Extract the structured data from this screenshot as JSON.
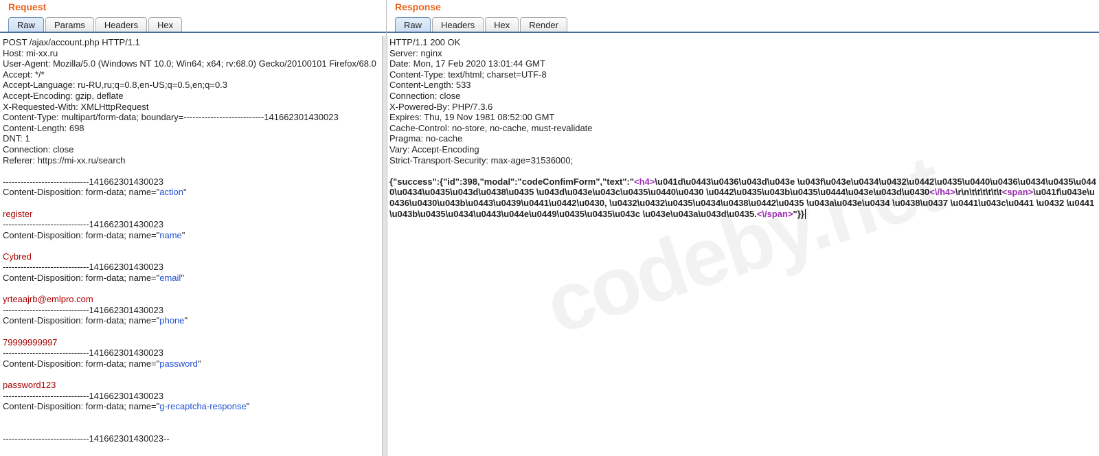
{
  "watermark": "codeby.net",
  "request": {
    "title": "Request",
    "tabs": [
      "Raw",
      "Params",
      "Headers",
      "Hex"
    ],
    "active_tab": 0,
    "request_line": "POST /ajax/account.php HTTP/1.1",
    "headers": [
      "Host: mi-xx.ru",
      "User-Agent: Mozilla/5.0 (Windows NT 10.0; Win64; x64; rv:68.0) Gecko/20100101 Firefox/68.0",
      "Accept: */*",
      "Accept-Language: ru-RU,ru;q=0.8,en-US;q=0.5,en;q=0.3",
      "Accept-Encoding: gzip, deflate",
      "X-Requested-With: XMLHttpRequest",
      "Content-Type: multipart/form-data; boundary=---------------------------141662301430023",
      "Content-Length: 698",
      "DNT: 1",
      "Connection: close",
      "Referer: https://mi-xx.ru/search"
    ],
    "boundary_line": "-----------------------------141662301430023",
    "boundary_end": "-----------------------------141662301430023--",
    "cd_prefix": "Content-Disposition: form-data; name=\"",
    "cd_suffix": "\"",
    "fields": [
      {
        "name": "action",
        "value": "register"
      },
      {
        "name": "name",
        "value": "Cybred"
      },
      {
        "name": "email",
        "value": "yrteaajrb@emlpro.com"
      },
      {
        "name": "phone",
        "value": "79999999997"
      },
      {
        "name": "password",
        "value": "password123"
      },
      {
        "name": "g-recaptcha-response",
        "value": ""
      }
    ]
  },
  "response": {
    "title": "Response",
    "tabs": [
      "Raw",
      "Headers",
      "Hex",
      "Render"
    ],
    "active_tab": 0,
    "status_line": "HTTP/1.1 200 OK",
    "headers": [
      "Server: nginx",
      "Date: Mon, 17 Feb 2020 13:01:44 GMT",
      "Content-Type: text/html; charset=UTF-8",
      "Content-Length: 533",
      "Connection: close",
      "X-Powered-By: PHP/7.3.6",
      "Expires: Thu, 19 Nov 1981 08:52:00 GMT",
      "Cache-Control: no-store, no-cache, must-revalidate",
      "Pragma: no-cache",
      "Vary: Accept-Encoding",
      "Strict-Transport-Security: max-age=31536000;"
    ],
    "body_parts": {
      "p1": "{\"success\":{\"id\":398,\"modal\":\"codeConfimForm\",\"text\":\"",
      "t1o": "<h4>",
      "p2": "\\u041d\\u0443\\u0436\\u043d\\u043e \\u043f\\u043e\\u0434\\u0432\\u0442\\u0435\\u0440\\u0436\\u0434\\u0435\\u0440\\u0434\\u0435\\u043d\\u0438\\u0435 \\u043d\\u043e\\u043c\\u0435\\u0440\\u0430 \\u0442\\u0435\\u043b\\u0435\\u0444\\u043e\\u043d\\u0430",
      "t1c": "<\\/h4>",
      "p3": "\\r\\n\\t\\t\\t\\t\\t\\t",
      "t2o": "<span>",
      "p4": "\\u041f\\u043e\\u0436\\u0430\\u043b\\u0443\\u0439\\u0441\\u0442\\u0430, \\u0432\\u0432\\u0435\\u0434\\u0438\\u0442\\u0435 \\u043a\\u043e\\u0434 \\u0438\\u0437 \\u0441\\u043c\\u0441 \\u0432 \\u0441\\u043b\\u0435\\u0434\\u0443\\u044e\\u0449\\u0435\\u0435\\u043c \\u043e\\u043a\\u043d\\u0435.",
      "t2c": "<\\/span>",
      "p5": "\"}}"
    }
  }
}
